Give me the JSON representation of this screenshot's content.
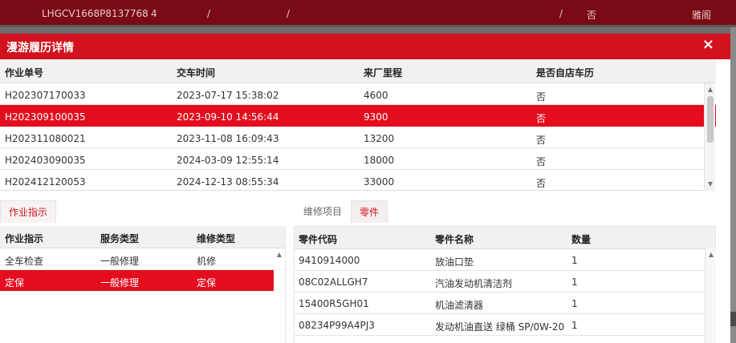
{
  "background_row": {
    "vin": "LHGCV1668P8137768",
    "num": "4",
    "slash1": "/",
    "slash2": "/",
    "slash3": "/",
    "flag": "否",
    "name": "雅阁"
  },
  "dialog": {
    "title": "漫游履历详情",
    "close_icon": "×"
  },
  "history_table": {
    "columns": [
      "作业单号",
      "交车时间",
      "来厂里程",
      "是否自店车历"
    ],
    "rows": [
      [
        "H202307170033",
        "2023-07-17 15:38:02",
        "4600",
        "否"
      ],
      [
        "H202309100035",
        "2023-09-10 14:56:44",
        "9300",
        "否"
      ],
      [
        "H202311080021",
        "2023-11-08 16:09:43",
        "13200",
        "否"
      ],
      [
        "H202403090035",
        "2024-03-09 12:55:14",
        "18000",
        "否"
      ],
      [
        "H202412120053",
        "2024-12-13 08:55:34",
        "33000",
        "否"
      ]
    ],
    "selected_index": 1
  },
  "job_panel": {
    "tab_label": "作业指示",
    "columns": [
      "作业指示",
      "服务类型",
      "维修类型"
    ],
    "rows": [
      [
        "全车检查",
        "一般修理",
        "机修"
      ],
      [
        "定保",
        "一般修理",
        "定保"
      ]
    ],
    "selected_index": 1
  },
  "parts_panel": {
    "tabs": [
      "维修项目",
      "零件"
    ],
    "active_tab": "零件",
    "columns": [
      "零件代码",
      "零件名称",
      "数量"
    ],
    "rows": [
      [
        "9410914000",
        "放油口垫",
        "1"
      ],
      [
        "08C02ALLGH7",
        "汽油发动机清洁剂",
        "1"
      ],
      [
        "15400R5GH01",
        "机油滤清器",
        "1"
      ],
      [
        "08234P99A4PJ3",
        "发动机油直送 绿桶 SP/0W-20",
        "1"
      ]
    ]
  },
  "colors": {
    "accent_red": "#e30d1e",
    "title_red": "#d2121e",
    "background_row": "#7a0a14"
  },
  "icons": {
    "scroll_up": "scroll-up-arrow-icon",
    "scroll_down": "scroll-down-arrow-icon",
    "close": "close-icon"
  }
}
